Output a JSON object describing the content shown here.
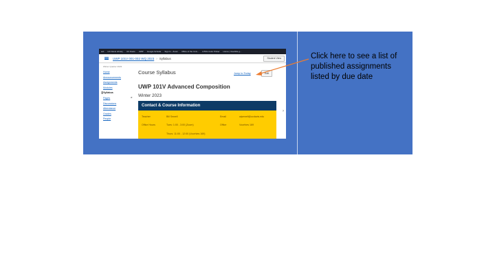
{
  "slide": {
    "panel_color": "#4472c4",
    "arrow_color": "#ed7d31"
  },
  "callout": {
    "text": "Click here to see a list of published assignments listed by due date"
  },
  "browser": {
    "bookmarks": [
      "ard",
      "UC Davis Library",
      "UC Davis",
      "UWP",
      "Google Scholar",
      "Sign In - Zoom",
      "Office of the Univ...",
      "HTML Color Picker",
      "Home | UseAble.g..."
    ]
  },
  "canvas": {
    "breadcrumb": {
      "course": "UWP 101V 001-002 WQ 2023",
      "separator": "›",
      "current": "Syllabus"
    },
    "student_view_label": "Student View",
    "sidebar": {
      "term": "Winter Quarter 2023",
      "items": [
        {
          "label": "Home",
          "active": false
        },
        {
          "label": "Announcements",
          "active": false
        },
        {
          "label": "Assignments",
          "active": false
        },
        {
          "label": "Modules",
          "active": false
        },
        {
          "label": "Syllabus",
          "active": true
        },
        {
          "label": "Pages",
          "active": false
        },
        {
          "label": "Discussions",
          "active": false
        },
        {
          "label": "Attendance",
          "active": false
        },
        {
          "label": "Grades",
          "active": false
        },
        {
          "label": "People",
          "active": false
        }
      ]
    },
    "page_heading": "Course Syllabus",
    "jump_to_today": "Jump to Today",
    "edit_label": "Edit",
    "course_title": "UWP 101V Advanced Composition",
    "term_label": "Winter 2023",
    "contact": {
      "header": "Contact & Course Information",
      "teacher_label": "Teacher",
      "teacher_value": "Bill Sewell",
      "email_label": "Email",
      "email_value": "wjsewell@ucdavis.edu",
      "office_hours_label": "Office Hours",
      "office_hours_1": "Tues: 1:00 - 3:00 (Zoom)",
      "office_hours_2": "Thurs: 11:00 - 12:00 (Voorhies 169)",
      "office_label": "Office",
      "office_value": "Voorhies 169"
    }
  }
}
